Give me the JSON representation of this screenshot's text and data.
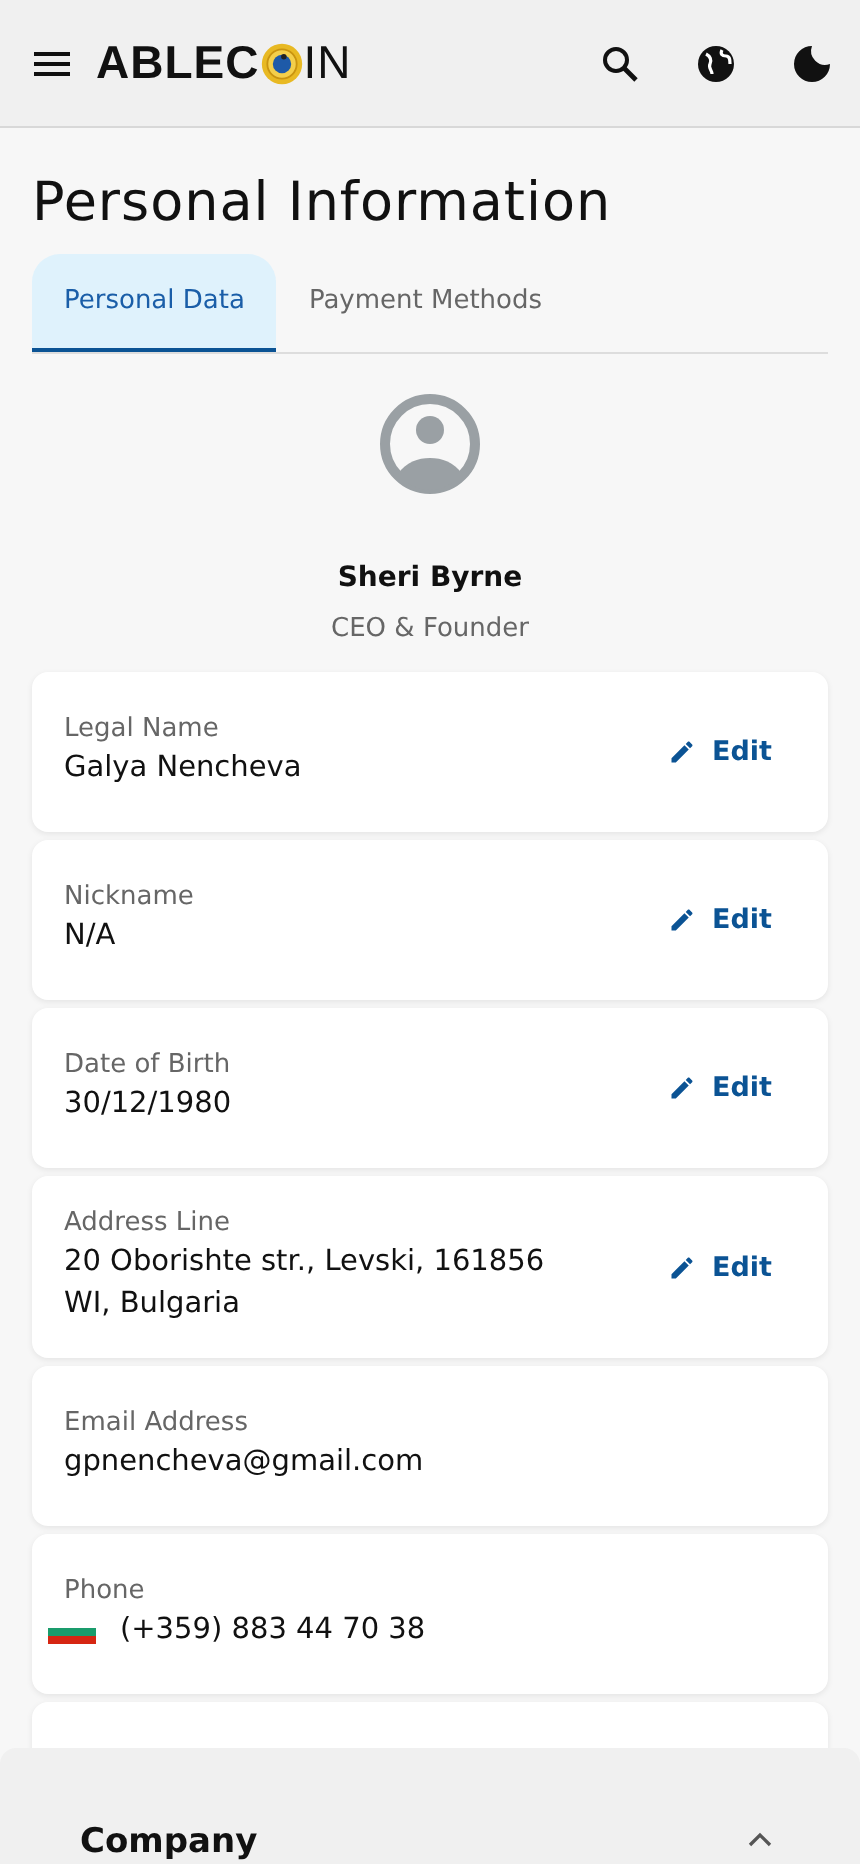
{
  "header": {
    "logo_left": "ABLEC",
    "logo_right": "IN"
  },
  "title": "Personal Information",
  "tabs": [
    {
      "label": "Personal Data",
      "selected": true
    },
    {
      "label": "Payment Methods",
      "selected": false
    }
  ],
  "profile": {
    "name": "Sheri Byrne",
    "role": "CEO & Founder"
  },
  "fields": [
    {
      "kind": "text",
      "label": "Legal Name",
      "value": "Galya Nencheva",
      "action": "Edit"
    },
    {
      "kind": "text",
      "label": "Nickname",
      "value": "N/A",
      "action": "Edit"
    },
    {
      "kind": "text",
      "label": "Date of Birth",
      "value": "30/12/1980",
      "action": "Edit"
    },
    {
      "kind": "text",
      "label": "Address Line",
      "value": "20 Oborishte str., Levski, 161856 WI, Bulgaria",
      "action": "Edit"
    },
    {
      "kind": "text",
      "label": "Email Address",
      "value": "gpnencheva@gmail.com"
    },
    {
      "kind": "phone",
      "label": "Phone",
      "value": "(+359) 883 44 70 38"
    }
  ],
  "footer": {
    "section": "Company",
    "expanded": true
  }
}
